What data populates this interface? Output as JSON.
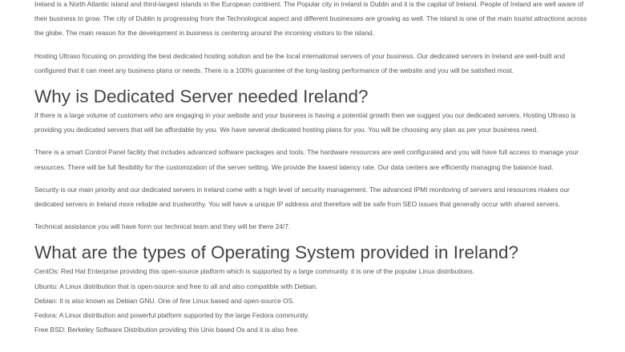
{
  "intro": {
    "p1": "Ireland is a North Atlantic island and third-largest islands in the European continent. The Popular city in Ireland is Dublin and it is the capital of Ireland. People of Ireland are well aware of their business to grow. The city of Dublin is progressing from the Technological aspect and different businesses are growing as well. The island is one of the main tourist attractions across the globe. The main reason for the development in business is centering around the incoming visitors to the island.",
    "p2": "Hosting Ultraso focusing on providing the best dedicated hosting solution and be the local international servers of your business. Our dedicated servers in Ireland are well-built and configured that it can meet any business plans or needs. There is a 100% guarantee of the long-lasting performance of the website and you will be satisfied most."
  },
  "section1": {
    "heading": "Why is Dedicated Server needed Ireland?",
    "p1": "If there is a large volume of customers who are engaging in your website and your business is having a potential growth then we suggest you our dedicated servers. Hosting Ultraso is providing you dedicated servers that will be affordable by you. We have several dedicated hosting plans for you. You will be choosing any plan as per your business need.",
    "p2": "There is a smart Control Panel facility that includes advanced software packages and tools. The hardware resources are well configurated and you will have full access to manage your resources. There will be full flexibility for the customization of the server setting. We provide the lowest latency rate. Our data centers are efficiently managing the balance load.",
    "p3": "Security is our main priority and our dedicated servers in Ireland come with a high level of security management. The advanced IPMI monitoring of servers and resources makes our dedicated servers in Ireland more reliable and trustworthy. You will have a unique IP address and therefore will be safe from SEO issues that generally occur with shared servers.",
    "p4": "Technical assistance you will have form our technical team and they will be there 24/7."
  },
  "section2": {
    "heading": "What are the types of Operating System provided in Ireland?",
    "items": [
      "CentOs: Red Hat Enterprise providing this open-source platform which is supported by a large community. it is one of the popular Linux distributions.",
      "Ubuntu: A Linux distribution that is open-source and free to all and also compatible with Debian.",
      "Debian: It is also known as Debian GNU. One of fine Linux based and open-source OS.",
      "Fedora: A Linux distribution and powerful platform supported by the large Fedora community.",
      "Free BSD: Berkeley Software Distribution providing this Unix based Os and it is also free."
    ]
  }
}
